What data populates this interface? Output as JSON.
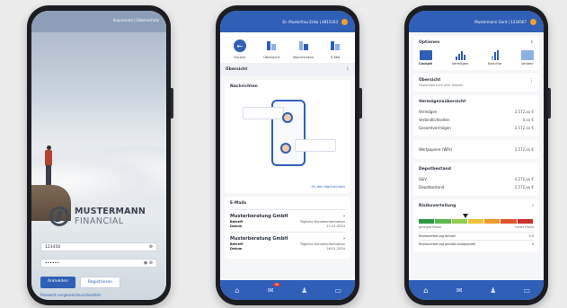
{
  "login": {
    "links": [
      "Impressum",
      "Datenschutz"
    ],
    "brand_line1": "MUSTERMANN",
    "brand_line2": "FINANCIAL",
    "username_value": "123456",
    "password_value": "••••••",
    "login_button": "Anmelden",
    "register_button": "Registrieren",
    "forgot_link": "Passwort vergessen/zurücksetzen"
  },
  "messages": {
    "topbar_user": "Dr. Musterfrau Erika | 4815163",
    "toolbar": [
      {
        "label": "Zurück",
        "icon": "back-arrow-icon"
      },
      {
        "label": "Übersicht",
        "icon": "overview-icon"
      },
      {
        "label": "Nachrichten",
        "icon": "messages-icon"
      },
      {
        "label": "E-Mai",
        "icon": "email-icon"
      }
    ],
    "section_title": "Übersicht",
    "news_card_title": "Nachrichten",
    "news_link": "Zu den Nachrichten",
    "email_card_title": "E-Mails",
    "emails": [
      {
        "sender": "Musterberatung GmbH",
        "subject_label": "Betreff",
        "subject": "Tägliche Kundeninformation",
        "date_label": "Datum",
        "date": "27.01.2024"
      },
      {
        "sender": "Musterberatung GmbH",
        "subject_label": "Betreff",
        "subject": "Tägliche Kundeninformation",
        "date_label": "Datum",
        "date": "26.01.2024"
      }
    ],
    "nav_badge": "99"
  },
  "dashboard": {
    "topbar_user": "Mustermann Gerd | 1234567",
    "options_title": "Optionen",
    "options": [
      {
        "label": "Cockpit",
        "selected": true
      },
      {
        "label": "Vermögen",
        "selected": false
      },
      {
        "label": "Berichte",
        "selected": false
      },
      {
        "label": "Verkehr",
        "selected": false
      }
    ],
    "overview_title": "Übersicht",
    "overview_subtitle": "Depotübersicht aller Depots",
    "assets_title": "Vermögensübersicht",
    "assets": [
      {
        "label": "Vermögen",
        "value": "2.572,xx €"
      },
      {
        "label": "Verbindlichkeiten",
        "value": "0,xx €"
      },
      {
        "label": "Gesamtvermögen",
        "value": "2.572,xx €"
      }
    ],
    "securities_label": "Wertpapiere (WPs)",
    "securities_value": "2.572,xx €",
    "depot_title": "Depotbestand",
    "depot": [
      {
        "label": "G&V",
        "value": "4.272,xx €"
      },
      {
        "label": "Depotbestand",
        "value": "2.572,xx €"
      }
    ],
    "risk_title": "Risikoverteilung",
    "risk_low": "geringes Risiko",
    "risk_high": "hohes Risiko",
    "risk_rows": [
      {
        "label": "Risikoverteilung aktuell",
        "value": "3,3"
      },
      {
        "label": "Risikoverteilung gemäß Anlageprofil",
        "value": "0"
      }
    ],
    "risk_colors": [
      "#2c9a45",
      "#5db84f",
      "#8fcf4f",
      "#f0c23a",
      "#f09a2b",
      "#e0562a",
      "#c8322a"
    ]
  }
}
